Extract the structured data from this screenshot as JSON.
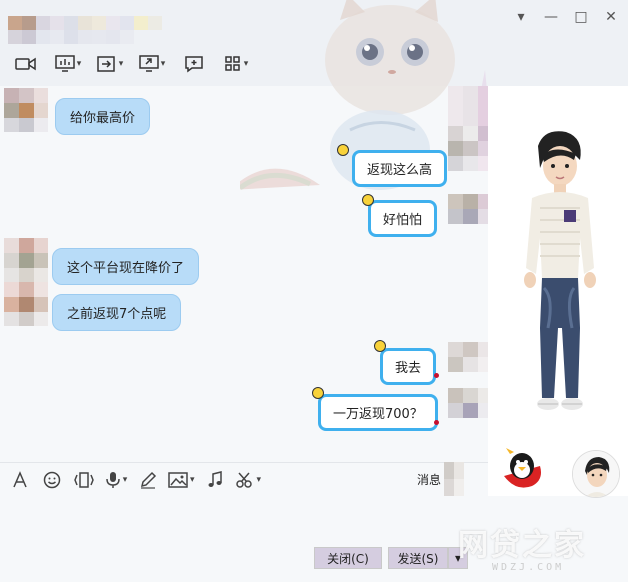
{
  "window": {
    "controls": {
      "menu": "▾",
      "minimize": "—",
      "maximize": "□",
      "close": "✕"
    }
  },
  "chat": {
    "messages": [
      {
        "side": "left",
        "text": "给你最高价"
      },
      {
        "side": "right",
        "text": "返现这么高"
      },
      {
        "side": "right",
        "text": "好怕怕"
      },
      {
        "side": "left",
        "text": "这个平台现在降价了"
      },
      {
        "side": "left",
        "text": "之前返现7个点呢"
      },
      {
        "side": "right",
        "text": "我去"
      },
      {
        "side": "right",
        "text": "一万返现700？"
      }
    ]
  },
  "input_toolbar": {
    "message_record_label": "消息"
  },
  "buttons": {
    "close": "关闭(C)",
    "send": "发送(S)",
    "send_arrow": "▾"
  },
  "watermark": {
    "main": "网贷之家",
    "sub": "WDZJ.COM"
  },
  "colors": {
    "bubble_left": "#b8dcf8",
    "bubble_right_border": "#3fb0ee",
    "button_bg": "#d5cde0"
  }
}
